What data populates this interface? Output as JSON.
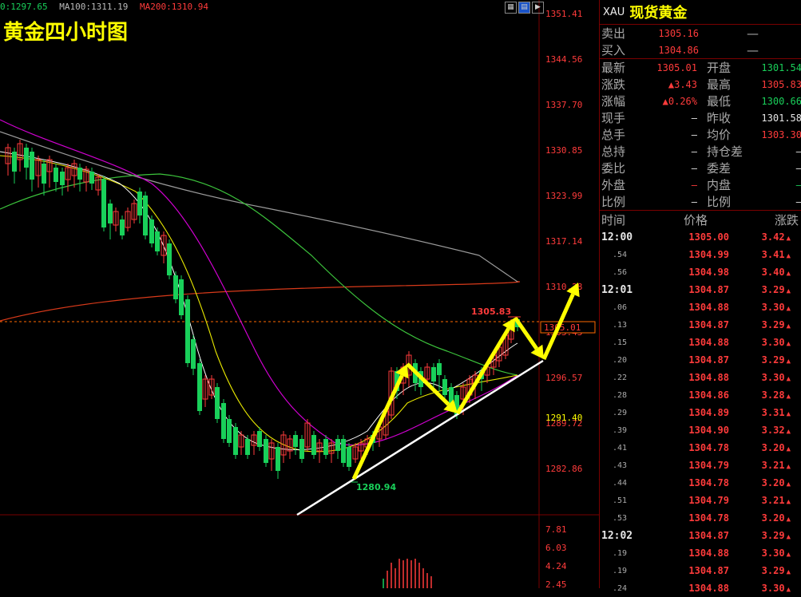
{
  "ma_legend": [
    {
      "label": "0:1297.65",
      "color": "#19d05a"
    },
    {
      "label": "MA100:1311.19",
      "color": "#bbbbbb"
    },
    {
      "label": "MA200:1310.94",
      "color": "#ff3b3b"
    }
  ],
  "chart_title": "黄金四小时图",
  "price_axis": [
    "1351.41",
    "1344.56",
    "1337.70",
    "1330.85",
    "1323.99",
    "1317.14",
    "1310.28",
    "1303.43",
    "1296.57",
    "1289.72",
    "1282.86"
  ],
  "volume_axis": [
    "7.81",
    "6.03",
    "4.24",
    "2.45"
  ],
  "current_price_tag": "1305.01",
  "crosshair_tag": "1291.40",
  "high_label": "1305.83",
  "low_label": "1280.94",
  "toolbar_icons": [
    "grid-icon",
    "chart-icon",
    "play-icon"
  ],
  "panel": {
    "code": "XAU",
    "name": "现货黄金",
    "bid_ask": [
      {
        "label": "卖出",
        "value": "1305.16",
        "extra": "—"
      },
      {
        "label": "买入",
        "value": "1304.86",
        "extra": "—"
      }
    ],
    "quotes": [
      {
        "l1": "最新",
        "v1": "1305.01",
        "c1": "red",
        "l2": "开盘",
        "v2": "1301.54",
        "c2": "green"
      },
      {
        "l1": "涨跌",
        "v1": "▲3.43",
        "c1": "red",
        "l2": "最高",
        "v2": "1305.83",
        "c2": "red"
      },
      {
        "l1": "涨幅",
        "v1": "▲0.26%",
        "c1": "red",
        "l2": "最低",
        "v2": "1300.66",
        "c2": "green"
      },
      {
        "l1": "现手",
        "v1": "—",
        "c1": "white",
        "l2": "昨收",
        "v2": "1301.58",
        "c2": "white"
      },
      {
        "l1": "总手",
        "v1": "—",
        "c1": "white",
        "l2": "均价",
        "v2": "1303.30",
        "c2": "red"
      },
      {
        "l1": "总持",
        "v1": "—",
        "c1": "white",
        "l2": "持仓差",
        "v2": "—",
        "c2": "white"
      },
      {
        "l1": "委比",
        "v1": "—",
        "c1": "white",
        "l2": "委差",
        "v2": "—",
        "c2": "white"
      },
      {
        "l1": "外盘",
        "v1": "—",
        "c1": "red",
        "l2": "内盘",
        "v2": "—",
        "c2": "green"
      },
      {
        "l1": "比例",
        "v1": "—",
        "c1": "white",
        "l2": "比例",
        "v2": "—",
        "c2": "white"
      }
    ],
    "tick_header": {
      "time": "时间",
      "price": "价格",
      "change": "涨跌"
    },
    "ticks": [
      {
        "time": "12:00",
        "big": true,
        "price": "1305.00",
        "change": "3.42"
      },
      {
        "time": ".54",
        "big": false,
        "price": "1304.99",
        "change": "3.41"
      },
      {
        "time": ".56",
        "big": false,
        "price": "1304.98",
        "change": "3.40"
      },
      {
        "time": "12:01",
        "big": true,
        "price": "1304.87",
        "change": "3.29"
      },
      {
        "time": ".06",
        "big": false,
        "price": "1304.88",
        "change": "3.30"
      },
      {
        "time": ".13",
        "big": false,
        "price": "1304.87",
        "change": "3.29"
      },
      {
        "time": ".15",
        "big": false,
        "price": "1304.88",
        "change": "3.30"
      },
      {
        "time": ".20",
        "big": false,
        "price": "1304.87",
        "change": "3.29"
      },
      {
        "time": ".22",
        "big": false,
        "price": "1304.88",
        "change": "3.30"
      },
      {
        "time": ".28",
        "big": false,
        "price": "1304.86",
        "change": "3.28"
      },
      {
        "time": ".29",
        "big": false,
        "price": "1304.89",
        "change": "3.31"
      },
      {
        "time": ".39",
        "big": false,
        "price": "1304.90",
        "change": "3.32"
      },
      {
        "time": ".41",
        "big": false,
        "price": "1304.78",
        "change": "3.20"
      },
      {
        "time": ".43",
        "big": false,
        "price": "1304.79",
        "change": "3.21"
      },
      {
        "time": ".44",
        "big": false,
        "price": "1304.78",
        "change": "3.20"
      },
      {
        "time": ".51",
        "big": false,
        "price": "1304.79",
        "change": "3.21"
      },
      {
        "time": ".53",
        "big": false,
        "price": "1304.78",
        "change": "3.20"
      },
      {
        "time": "12:02",
        "big": true,
        "price": "1304.87",
        "change": "3.29"
      },
      {
        "time": ".19",
        "big": false,
        "price": "1304.88",
        "change": "3.30"
      },
      {
        "time": ".19",
        "big": false,
        "price": "1304.87",
        "change": "3.29"
      },
      {
        "time": ".24",
        "big": false,
        "price": "1304.88",
        "change": "3.30"
      }
    ]
  }
}
